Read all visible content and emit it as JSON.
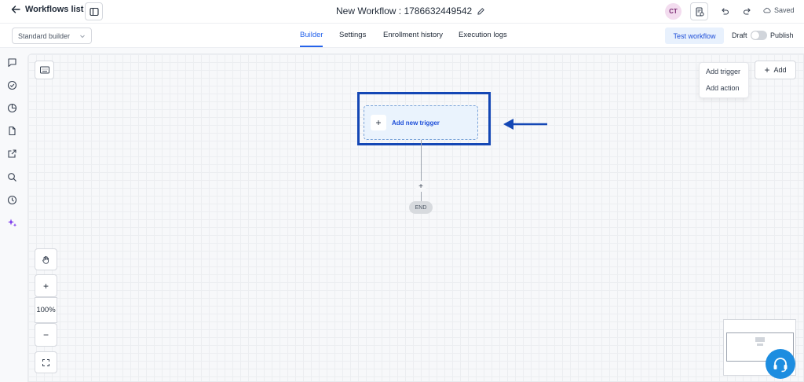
{
  "header": {
    "back_label": "Workflows list",
    "workflow_title": "New Workflow : 1786632449542",
    "avatar_initials": "CT",
    "saved_label": "Saved"
  },
  "subbar": {
    "builder_select": "Standard builder",
    "tabs": [
      {
        "label": "Builder",
        "active": true
      },
      {
        "label": "Settings",
        "active": false
      },
      {
        "label": "Enrollment history",
        "active": false
      },
      {
        "label": "Execution logs",
        "active": false
      }
    ],
    "test_workflow_label": "Test workflow",
    "draft_label": "Draft",
    "publish_label": "Publish"
  },
  "canvas": {
    "trigger_label": "Add new trigger",
    "end_label": "END",
    "add_button_label": "Add",
    "add_menu": [
      "Add trigger",
      "Add action"
    ],
    "zoom_in": "+",
    "zoom_level": "100%",
    "zoom_out": "−"
  },
  "colors": {
    "accent": "#2563eb",
    "highlight_outline": "#1447b5",
    "help_button": "#1d8de0"
  }
}
